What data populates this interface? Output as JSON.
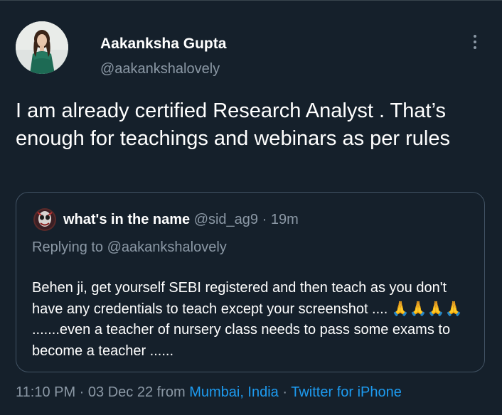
{
  "author": {
    "name": "Aakanksha Gupta",
    "handle": "@aakankshalovely"
  },
  "tweet": {
    "text": "I am already certified Research Analyst . That’s enough for teachings and webinars as per rules"
  },
  "quoted": {
    "name": "what's in the name",
    "handle": "@sid_ag9",
    "separator": "·",
    "time": "19m",
    "replying_to": "Replying to @aakankshalovely",
    "text": "Behen ji, get yourself SEBI registered and then teach as you don't have any credentials to teach except your screenshot .... 🙏🙏🙏🙏 .......even a teacher of nursery class needs to pass some exams to become a teacher ......"
  },
  "footer": {
    "timestamp": "11:10 PM · 03 Dec 22 from",
    "location": "Mumbai, India",
    "separator": "·",
    "source": "Twitter for iPhone"
  },
  "colors": {
    "background": "#15202b",
    "text": "#ffffff",
    "muted": "#8b98a5",
    "link": "#1d9bf0",
    "border": "#425364"
  },
  "icons": {
    "more": "more-vertical-icon"
  }
}
